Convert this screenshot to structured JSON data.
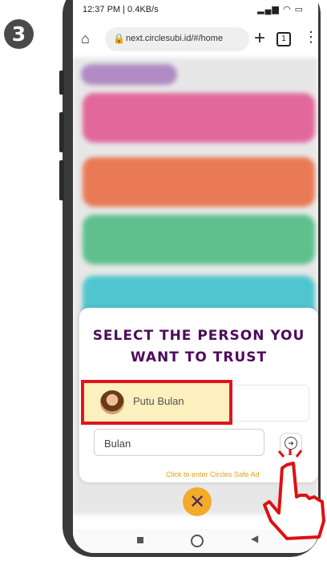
{
  "step": {
    "number": "3"
  },
  "statusbar": {
    "time_speed": "12:37 PM | 0.4KB/s",
    "icons": "signal wifi battery"
  },
  "browser": {
    "url": "next.circlesubi.id/#/home",
    "tab_count": "1",
    "icons": {
      "home": "home-icon",
      "lock": "lock-icon",
      "new_tab": "plus-icon",
      "menu": "kebab-menu-icon"
    }
  },
  "modal": {
    "title": "SELECT THE PERSON YOU WANT TO TRUST",
    "person": {
      "name": "Putu Bulan"
    },
    "search": {
      "value": "Bulan"
    },
    "hint": "Click to enter Circles Safe Ad"
  },
  "close_button": {
    "label": "✕"
  },
  "colors": {
    "title": "#4d0b5a",
    "accent": "#f2ab2b",
    "highlight_border": "#e0141e",
    "hint": "#e8a20d"
  }
}
